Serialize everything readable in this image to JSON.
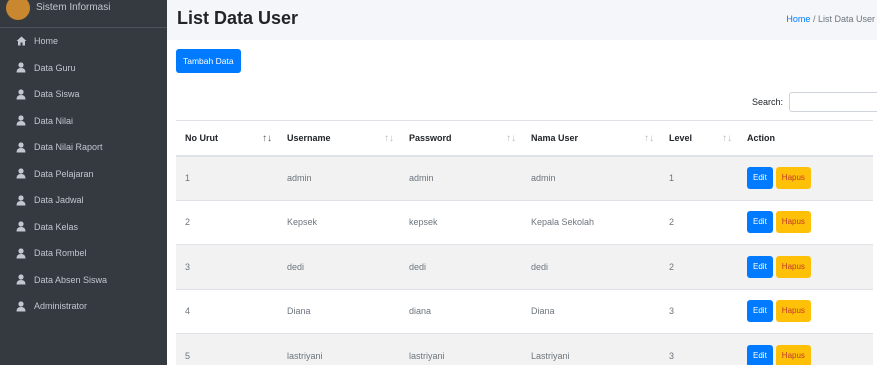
{
  "sidebar": {
    "brand": "Sistem Informasi",
    "items": [
      {
        "label": "Home",
        "icon": "home-icon"
      },
      {
        "label": "Data Guru",
        "icon": "user-icon"
      },
      {
        "label": "Data Siswa",
        "icon": "user-icon"
      },
      {
        "label": "Data Nilai",
        "icon": "user-icon"
      },
      {
        "label": "Data Nilai Raport",
        "icon": "user-icon"
      },
      {
        "label": "Data Pelajaran",
        "icon": "user-icon"
      },
      {
        "label": "Data Jadwal",
        "icon": "user-icon"
      },
      {
        "label": "Data Kelas",
        "icon": "user-icon"
      },
      {
        "label": "Data Rombel",
        "icon": "user-icon"
      },
      {
        "label": "Data Absen Siswa",
        "icon": "user-icon"
      },
      {
        "label": "Administrator",
        "icon": "user-icon"
      }
    ]
  },
  "header": {
    "title": "List Data User",
    "breadcrumb_home": "Home",
    "breadcrumb_sep": "/",
    "breadcrumb_current": "List Data User"
  },
  "toolbar": {
    "add_label": "Tambah Data",
    "search_label": "Search:"
  },
  "table": {
    "columns": [
      "No Urut",
      "Username",
      "Password",
      "Nama User",
      "Level",
      "Action"
    ],
    "rows": [
      {
        "no": "1",
        "username": "admin",
        "password": "admin",
        "nama": "admin",
        "level": "1"
      },
      {
        "no": "2",
        "username": "Kepsek",
        "password": "kepsek",
        "nama": "Kepala Sekolah",
        "level": "2"
      },
      {
        "no": "3",
        "username": "dedi",
        "password": "dedi",
        "nama": "dedi",
        "level": "2"
      },
      {
        "no": "4",
        "username": "Diana",
        "password": "diana",
        "nama": "Diana",
        "level": "3"
      },
      {
        "no": "5",
        "username": "lastriyani",
        "password": "lastriyani",
        "nama": "Lastriyani",
        "level": "3"
      }
    ],
    "edit_label": "Edit",
    "delete_label": "Hapus"
  }
}
